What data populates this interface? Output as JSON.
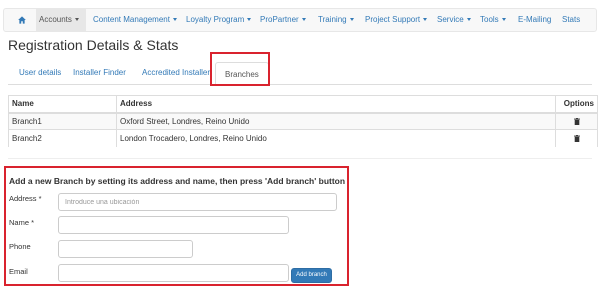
{
  "nav": {
    "items": [
      {
        "label": "Accounts",
        "caret": true,
        "active": true
      },
      {
        "label": "Content Management",
        "caret": true
      },
      {
        "label": "Loyalty Program",
        "caret": true
      },
      {
        "label": "ProPartner",
        "caret": true
      },
      {
        "label": "Training",
        "caret": true
      },
      {
        "label": "Project Support",
        "caret": true
      },
      {
        "label": "Service",
        "caret": true
      },
      {
        "label": "Tools",
        "caret": true
      },
      {
        "label": "E-Mailing",
        "caret": false
      },
      {
        "label": "Stats",
        "caret": false
      }
    ],
    "home_icon": "home-icon"
  },
  "page": {
    "title": "Registration Details & Stats"
  },
  "tabs": [
    {
      "label": "User details",
      "active": false
    },
    {
      "label": "Installer Finder",
      "active": false
    },
    {
      "label": "Accredited Installer",
      "active": false
    },
    {
      "label": "Branches",
      "active": true
    }
  ],
  "table": {
    "headers": {
      "name": "Name",
      "address": "Address",
      "options": "Options"
    },
    "rows": [
      {
        "name": "Branch1",
        "address": "Oxford Street, Londres, Reino Unido"
      },
      {
        "name": "Branch2",
        "address": "London Trocadero, Londres, Reino Unido"
      }
    ],
    "delete_icon": "trash-icon"
  },
  "form": {
    "heading": "Add a new Branch by setting its address and name, then press 'Add branch' button",
    "address_label": "Address *",
    "address_placeholder": "Introduce una ubicación",
    "address_value": "",
    "name_label": "Name *",
    "name_value": "",
    "phone_label": "Phone",
    "phone_value": "",
    "email_label": "Email",
    "email_value": "",
    "submit_label": "Add branch"
  },
  "colors": {
    "link": "#337ab7",
    "highlight_border": "#d9232e",
    "button_primary": "#337ab7"
  }
}
